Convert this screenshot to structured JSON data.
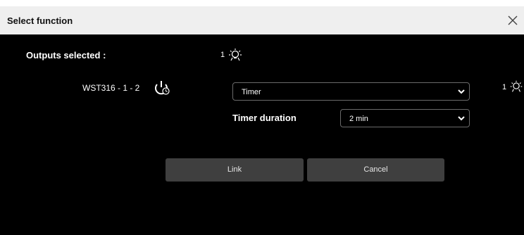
{
  "dialog": {
    "title": "Select function",
    "close_icon": "close-icon"
  },
  "outputs": {
    "label": "Outputs selected :",
    "count": "1",
    "icon": "light-icon"
  },
  "row": {
    "device": "WST316 - 1 - 2",
    "device_icon": "timer-power-icon",
    "function_select": {
      "value": "Timer"
    },
    "right_count": "1",
    "right_icon": "light-icon"
  },
  "timer": {
    "label": "Timer duration",
    "select": {
      "value": "2 min"
    }
  },
  "buttons": {
    "link": "Link",
    "cancel": "Cancel"
  }
}
